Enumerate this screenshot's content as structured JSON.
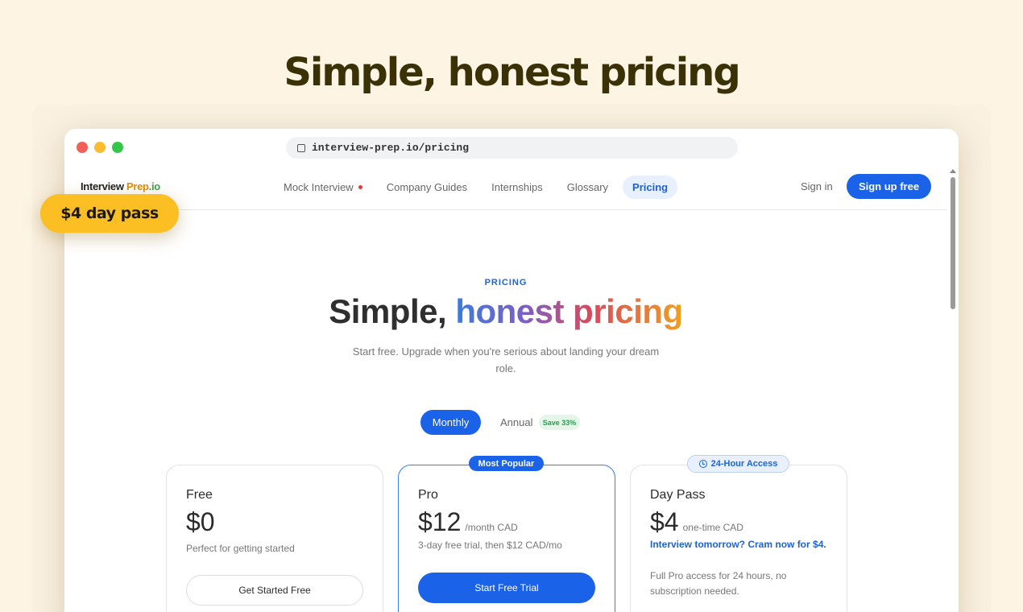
{
  "hero": {
    "title": "Simple, honest pricing"
  },
  "badge": {
    "label": "$4 day pass"
  },
  "browser": {
    "url": "interview-prep.io/pricing"
  },
  "navbar": {
    "logo": {
      "part1": "Interview ",
      "part2": "Prep",
      "part3": ".io"
    },
    "links": [
      {
        "label": "Mock Interview",
        "has_dot": true
      },
      {
        "label": "Company Guides"
      },
      {
        "label": "Internships"
      },
      {
        "label": "Glossary"
      },
      {
        "label": "Pricing",
        "active": true
      }
    ],
    "signin": "Sign in",
    "signup": "Sign up free"
  },
  "pricing": {
    "section_label": "PRICING",
    "title_plain": "Simple, ",
    "title_gradient": "honest pricing",
    "subtitle": "Start free. Upgrade when you're serious about landing your dream role.",
    "toggle": {
      "monthly": "Monthly",
      "annual": "Annual",
      "save": "Save 33%"
    }
  },
  "plans": [
    {
      "name": "Free",
      "price": "$0",
      "period": "",
      "desc": "Perfect for getting started",
      "cta": "Get Started Free"
    },
    {
      "name": "Pro",
      "badge": "Most Popular",
      "price": "$12",
      "period": "/month CAD",
      "desc": "3-day free trial, then $12 CAD/mo",
      "cta": "Start Free Trial"
    },
    {
      "name": "Day Pass",
      "badge": "24-Hour Access",
      "price": "$4",
      "period": "one-time CAD",
      "highlight": "Interview tomorrow? Cram now for $4.",
      "desc": "Full Pro access for 24 hours, no subscription needed."
    }
  ],
  "colors": {
    "accent": "#1a63e8",
    "background": "#fdf4e3",
    "badge": "#fbbf24"
  }
}
